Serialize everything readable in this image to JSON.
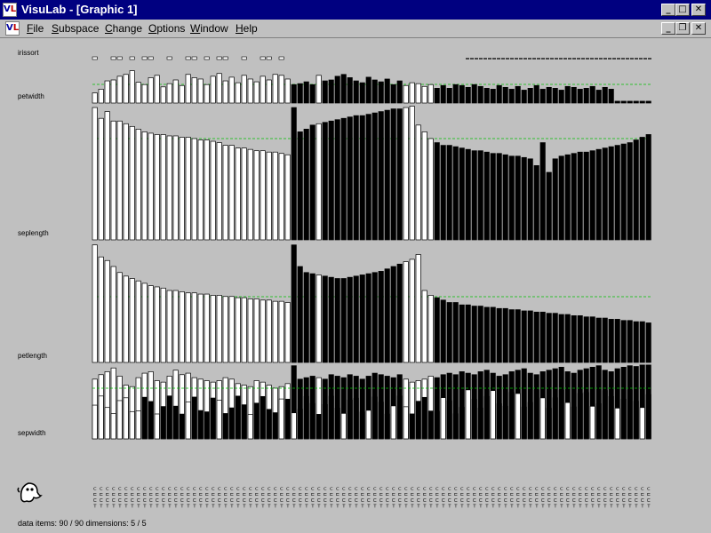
{
  "window": {
    "title": "VisuLab - [Graphic 1]",
    "buttons": [
      "minimize",
      "maximize",
      "close"
    ],
    "doc_buttons": [
      "minimize",
      "restore",
      "close"
    ]
  },
  "menu": {
    "items": [
      "File",
      "Subspace",
      "Change",
      "Options",
      "Window",
      "Help"
    ]
  },
  "plot": {
    "dimensions": [
      "irissort",
      "petwidth",
      "seplength",
      "petlength",
      "sepwidth"
    ],
    "reference_line_color": "#00c000",
    "selected_color": "#000000",
    "unselected_color": "#ffffff"
  },
  "chart_data": {
    "type": "bar",
    "title": "",
    "note": "Parallel stacked bar plot of 90 data items over 5 dimensions; values are relative bar heights (0-1) read from the display. 0 = white/unselected, 1 = black/selected.",
    "selected": [
      0,
      0,
      0,
      0,
      0,
      0,
      0,
      0,
      0,
      0,
      0,
      0,
      0,
      0,
      0,
      0,
      0,
      0,
      0,
      0,
      0,
      0,
      0,
      0,
      0,
      0,
      0,
      0,
      0,
      0,
      0,
      0,
      1,
      1,
      1,
      1,
      0,
      1,
      1,
      1,
      1,
      1,
      1,
      1,
      1,
      1,
      1,
      1,
      1,
      1,
      0,
      0,
      0,
      0,
      0,
      1,
      1,
      1,
      1,
      1,
      1,
      1,
      1,
      1,
      1,
      1,
      1,
      1,
      1,
      1,
      1,
      1,
      1,
      1,
      1,
      1,
      1,
      1,
      1,
      1,
      1,
      1,
      1,
      1,
      1,
      1,
      1,
      1,
      1,
      1
    ],
    "series": [
      {
        "name": "irissort",
        "values": [
          0.22,
          0.3,
          0.48,
          0.5,
          0.58,
          0.62,
          0.7,
          0.45,
          0.4,
          0.55,
          0.6,
          0.35,
          0.42,
          0.5,
          0.38,
          0.62,
          0.55,
          0.52,
          0.4,
          0.58,
          0.64,
          0.48,
          0.56,
          0.44,
          0.6,
          0.52,
          0.46,
          0.58,
          0.5,
          0.62,
          0.6,
          0.52,
          0.4,
          0.42,
          0.46,
          0.4,
          0.6,
          0.48,
          0.5,
          0.58,
          0.62,
          0.55,
          0.48,
          0.44,
          0.56,
          0.5,
          0.46,
          0.52,
          0.4,
          0.48,
          0.38,
          0.44,
          0.42,
          0.36,
          0.4,
          0.32,
          0.38,
          0.32,
          0.4,
          0.38,
          0.34,
          0.4,
          0.36,
          0.32,
          0.3,
          0.38,
          0.34,
          0.3,
          0.36,
          0.28,
          0.32,
          0.38,
          0.3,
          0.34,
          0.32,
          0.28,
          0.36,
          0.34,
          0.3,
          0.32,
          0.36,
          0.28,
          0.34,
          0.3,
          0.32,
          0.36,
          0.3,
          0.34,
          0.32,
          0.36
        ]
      },
      {
        "name": "petwidth",
        "values": [
          0.98,
          0.9,
          0.95,
          0.88,
          0.88,
          0.86,
          0.84,
          0.82,
          0.8,
          0.79,
          0.78,
          0.78,
          0.77,
          0.77,
          0.76,
          0.76,
          0.75,
          0.74,
          0.74,
          0.73,
          0.72,
          0.7,
          0.7,
          0.68,
          0.68,
          0.67,
          0.66,
          0.66,
          0.65,
          0.65,
          0.64,
          0.63,
          0.98,
          0.8,
          0.82,
          0.85,
          0.86,
          0.87,
          0.88,
          0.89,
          0.9,
          0.91,
          0.92,
          0.92,
          0.93,
          0.94,
          0.95,
          0.96,
          0.97,
          0.97,
          0.98,
          0.99,
          0.85,
          0.8,
          0.75,
          0.72,
          0.7,
          0.7,
          0.69,
          0.68,
          0.67,
          0.66,
          0.66,
          0.65,
          0.64,
          0.64,
          0.63,
          0.62,
          0.62,
          0.61,
          0.6,
          0.55,
          0.72,
          0.5,
          0.6,
          0.62,
          0.63,
          0.64,
          0.65,
          0.65,
          0.66,
          0.67,
          0.68,
          0.69,
          0.7,
          0.71,
          0.72,
          0.74,
          0.76,
          0.78
        ]
      },
      {
        "name": "seplength",
        "values": [
          0.98,
          0.88,
          0.85,
          0.8,
          0.75,
          0.72,
          0.7,
          0.68,
          0.66,
          0.64,
          0.63,
          0.62,
          0.6,
          0.6,
          0.59,
          0.58,
          0.58,
          0.57,
          0.57,
          0.56,
          0.56,
          0.55,
          0.55,
          0.54,
          0.54,
          0.53,
          0.53,
          0.52,
          0.52,
          0.51,
          0.51,
          0.5,
          0.98,
          0.8,
          0.75,
          0.74,
          0.73,
          0.72,
          0.71,
          0.7,
          0.7,
          0.71,
          0.72,
          0.73,
          0.74,
          0.75,
          0.76,
          0.78,
          0.8,
          0.82,
          0.84,
          0.86,
          0.9,
          0.6,
          0.56,
          0.54,
          0.52,
          0.5,
          0.5,
          0.48,
          0.48,
          0.47,
          0.47,
          0.46,
          0.46,
          0.45,
          0.45,
          0.44,
          0.44,
          0.43,
          0.43,
          0.42,
          0.42,
          0.41,
          0.41,
          0.4,
          0.4,
          0.39,
          0.39,
          0.38,
          0.38,
          0.37,
          0.37,
          0.36,
          0.36,
          0.35,
          0.35,
          0.34,
          0.34,
          0.33
        ]
      },
      {
        "name": "petlength",
        "values": [
          0.8,
          0.86,
          0.9,
          0.95,
          0.84,
          0.72,
          0.7,
          0.82,
          0.88,
          0.9,
          0.78,
          0.76,
          0.84,
          0.92,
          0.86,
          0.88,
          0.82,
          0.8,
          0.78,
          0.76,
          0.78,
          0.82,
          0.8,
          0.74,
          0.72,
          0.7,
          0.78,
          0.76,
          0.72,
          0.68,
          0.7,
          0.74,
          0.98,
          0.8,
          0.82,
          0.84,
          0.82,
          0.8,
          0.86,
          0.84,
          0.82,
          0.86,
          0.84,
          0.8,
          0.84,
          0.88,
          0.86,
          0.84,
          0.82,
          0.86,
          0.8,
          0.76,
          0.78,
          0.8,
          0.84,
          0.82,
          0.86,
          0.88,
          0.86,
          0.9,
          0.88,
          0.86,
          0.9,
          0.92,
          0.88,
          0.84,
          0.86,
          0.9,
          0.92,
          0.94,
          0.88,
          0.86,
          0.9,
          0.92,
          0.94,
          0.96,
          0.9,
          0.88,
          0.92,
          0.94,
          0.96,
          0.98,
          0.92,
          0.9,
          0.94,
          0.96,
          0.98,
          0.97,
          0.99,
          0.99
        ]
      },
      {
        "name": "sepwidth",
        "values": []
      }
    ]
  },
  "axis_labels": {
    "bottom_rows": 4
  },
  "status": {
    "text": "data items:  90 / 90  dimensions:  5 / 5"
  }
}
